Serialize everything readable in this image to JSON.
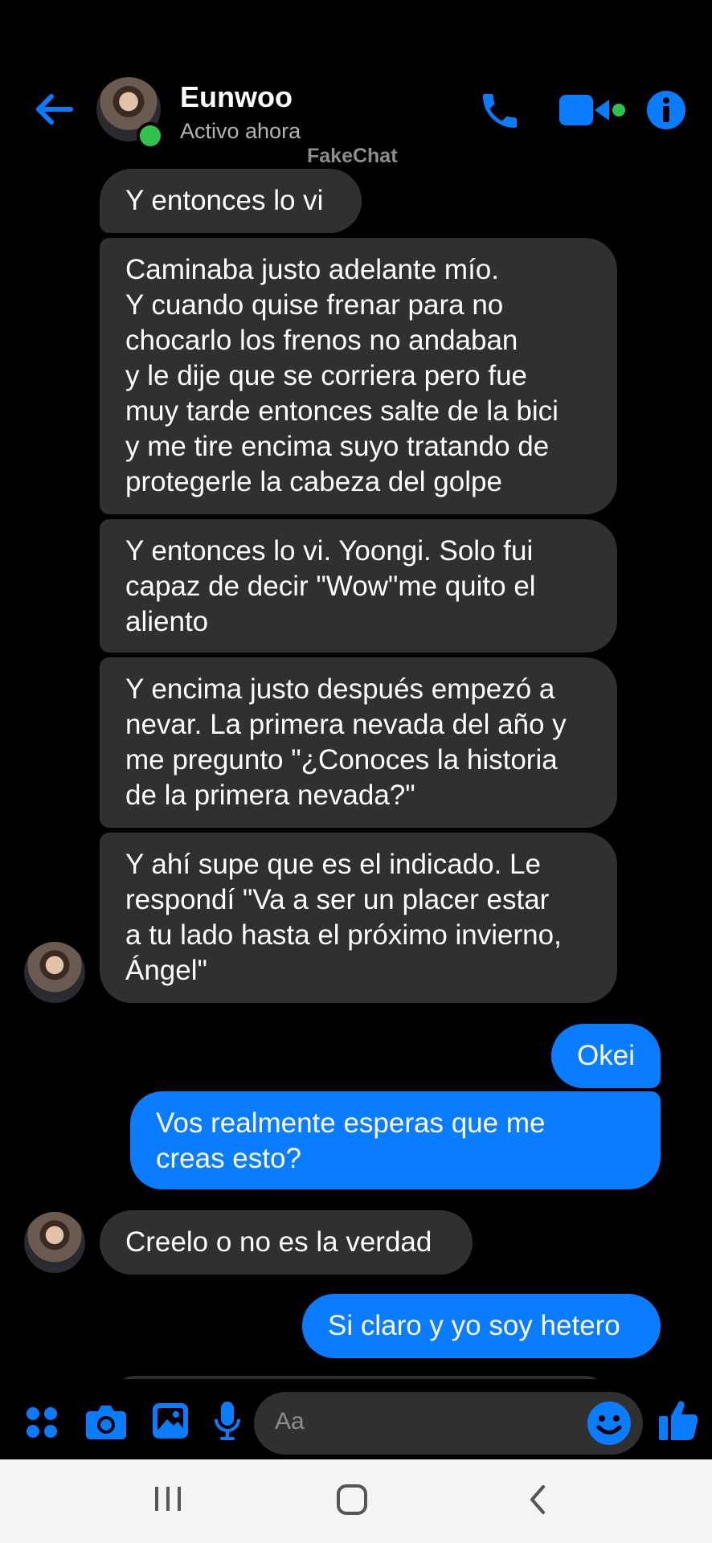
{
  "header": {
    "contact_name": "Eunwoo",
    "status": "Activo ahora",
    "watermark": "FakeChat",
    "icons": [
      "back-arrow-icon",
      "phone-icon",
      "video-icon",
      "info-icon"
    ]
  },
  "messages": [
    {
      "from": "them",
      "text": "Y entonces lo vi"
    },
    {
      "from": "them",
      "text": "Caminaba justo adelante mío.\nY cuando quise frenar para no\nchocarlo los frenos no andaban\ny le dije que se corriera pero fue\nmuy tarde entonces salte de la bici\ny me tire encima suyo tratando de\nprotegerle la cabeza del golpe"
    },
    {
      "from": "them",
      "text": "Y entonces lo vi. Yoongi. Solo fui\ncapaz de decir \"Wow\"me quito el\naliento"
    },
    {
      "from": "them",
      "text": "Y encima justo después empezó a\nnevar. La primera nevada del año y\nme pregunto \"¿Conoces la historia\nde la primera nevada?\""
    },
    {
      "from": "them",
      "text": "Y ahí supe que es el indicado. Le\nrespondí \"Va a ser un placer estar\na tu lado hasta el próximo invierno,\nÁngel\""
    },
    {
      "from": "me",
      "text": "Okei"
    },
    {
      "from": "me",
      "text": "Vos realmente esperas que me\ncreas esto?"
    },
    {
      "from": "them",
      "text": "Creelo o no es la verdad"
    },
    {
      "from": "me",
      "text": "Si claro y yo soy hetero"
    }
  ],
  "composer": {
    "placeholder": "Aa",
    "icons": [
      "apps-icon",
      "camera-icon",
      "gallery-icon",
      "microphone-icon",
      "emoji-icon",
      "thumbs-up-icon"
    ]
  },
  "navbar": {
    "icons": [
      "recent-apps-icon",
      "home-icon",
      "back-icon"
    ]
  },
  "colors": {
    "accent": "#0a7cff",
    "incoming_bubble": "#303030",
    "online": "#31c24d",
    "background": "#000000"
  }
}
